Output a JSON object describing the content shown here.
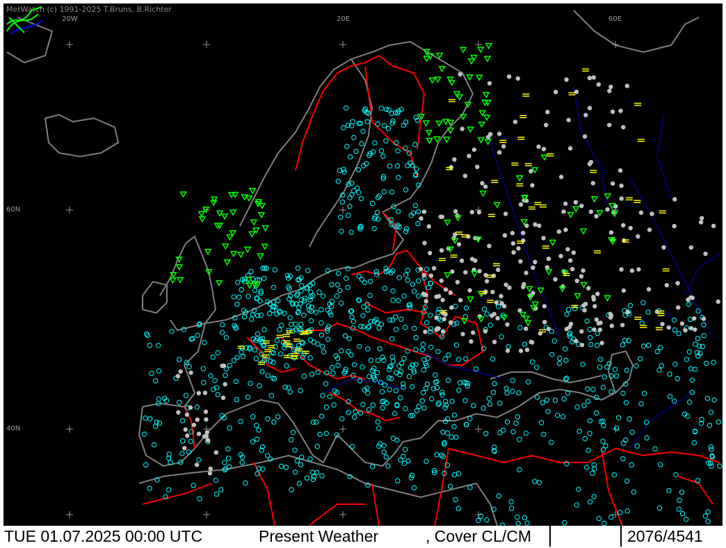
{
  "app": {
    "credit": "MetWatch  (c) 1991-2025 T.Bruns, B.Richter"
  },
  "graticule": {
    "lon_labels": [
      "20W",
      "20E",
      "60E"
    ],
    "lat_labels": [
      "60N",
      "40N"
    ]
  },
  "status_bar": {
    "datetime": "TUE 01.07.2025 00:00 UTC",
    "product": "Present Weather",
    "overlay": ", Cover CL/CM",
    "count": "2076/4541"
  },
  "colors": {
    "background": "#000000",
    "coastline": "#808080",
    "borders": "#ff0000",
    "rivers": "#00008b",
    "clear_station": "#00ffff",
    "cloudy_station": "#c0c0c0",
    "fog_mist": "#ffff00",
    "precipitation": "#00ff00",
    "dust_sand": "#c0c0c0"
  },
  "legend_icons": [
    "metwatch-logo-icon"
  ]
}
